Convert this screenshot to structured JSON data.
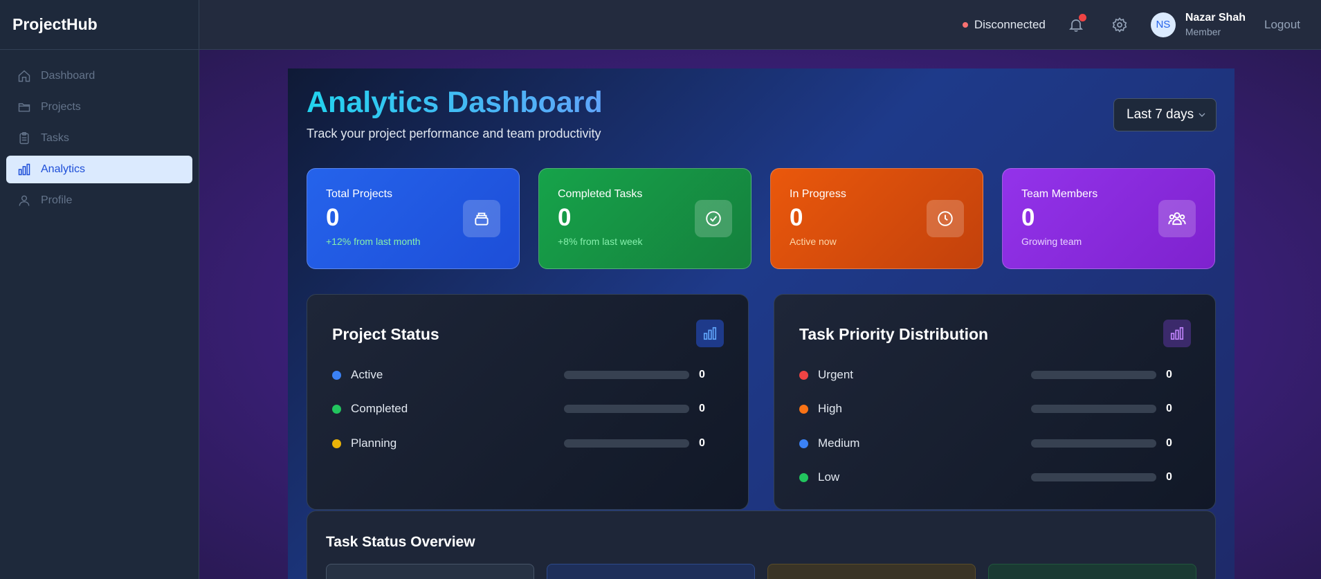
{
  "app": {
    "brand": "ProjectHub"
  },
  "sidebar": {
    "items": [
      {
        "label": "Dashboard",
        "icon": "home-icon"
      },
      {
        "label": "Projects",
        "icon": "folder-icon"
      },
      {
        "label": "Tasks",
        "icon": "clipboard-icon"
      },
      {
        "label": "Analytics",
        "icon": "bar-chart-icon",
        "active": true
      },
      {
        "label": "Profile",
        "icon": "user-icon"
      }
    ]
  },
  "header": {
    "connection_status": "Disconnected",
    "user_initials": "NS",
    "user_name": "Nazar Shah",
    "user_role": "Member",
    "logout_label": "Logout"
  },
  "page": {
    "title": "Analytics Dashboard",
    "subtitle": "Track your project performance and team productivity",
    "range_selected": "Last 7 days"
  },
  "stats": [
    {
      "label": "Total Projects",
      "value": "0",
      "sub": "+12% from last month",
      "icon": "stack-icon"
    },
    {
      "label": "Completed Tasks",
      "value": "0",
      "sub": "+8% from last week",
      "icon": "check-circle-icon"
    },
    {
      "label": "In Progress",
      "value": "0",
      "sub": "Active now",
      "icon": "clock-icon"
    },
    {
      "label": "Team Members",
      "value": "0",
      "sub": "Growing team",
      "icon": "team-icon"
    }
  ],
  "project_status": {
    "title": "Project Status",
    "rows": [
      {
        "label": "Active",
        "value": "0",
        "color": "#3b82f6",
        "fraction": 0
      },
      {
        "label": "Completed",
        "value": "0",
        "color": "#22c55e",
        "fraction": 0
      },
      {
        "label": "Planning",
        "value": "0",
        "color": "#eab308",
        "fraction": 0
      }
    ]
  },
  "task_priority": {
    "title": "Task Priority Distribution",
    "rows": [
      {
        "label": "Urgent",
        "value": "0",
        "color": "#ef4444",
        "fraction": 0
      },
      {
        "label": "High",
        "value": "0",
        "color": "#f97316",
        "fraction": 0
      },
      {
        "label": "Medium",
        "value": "0",
        "color": "#3b82f6",
        "fraction": 0
      },
      {
        "label": "Low",
        "value": "0",
        "color": "#22c55e",
        "fraction": 0
      }
    ]
  },
  "task_status_overview": {
    "title": "Task Status Overview"
  }
}
